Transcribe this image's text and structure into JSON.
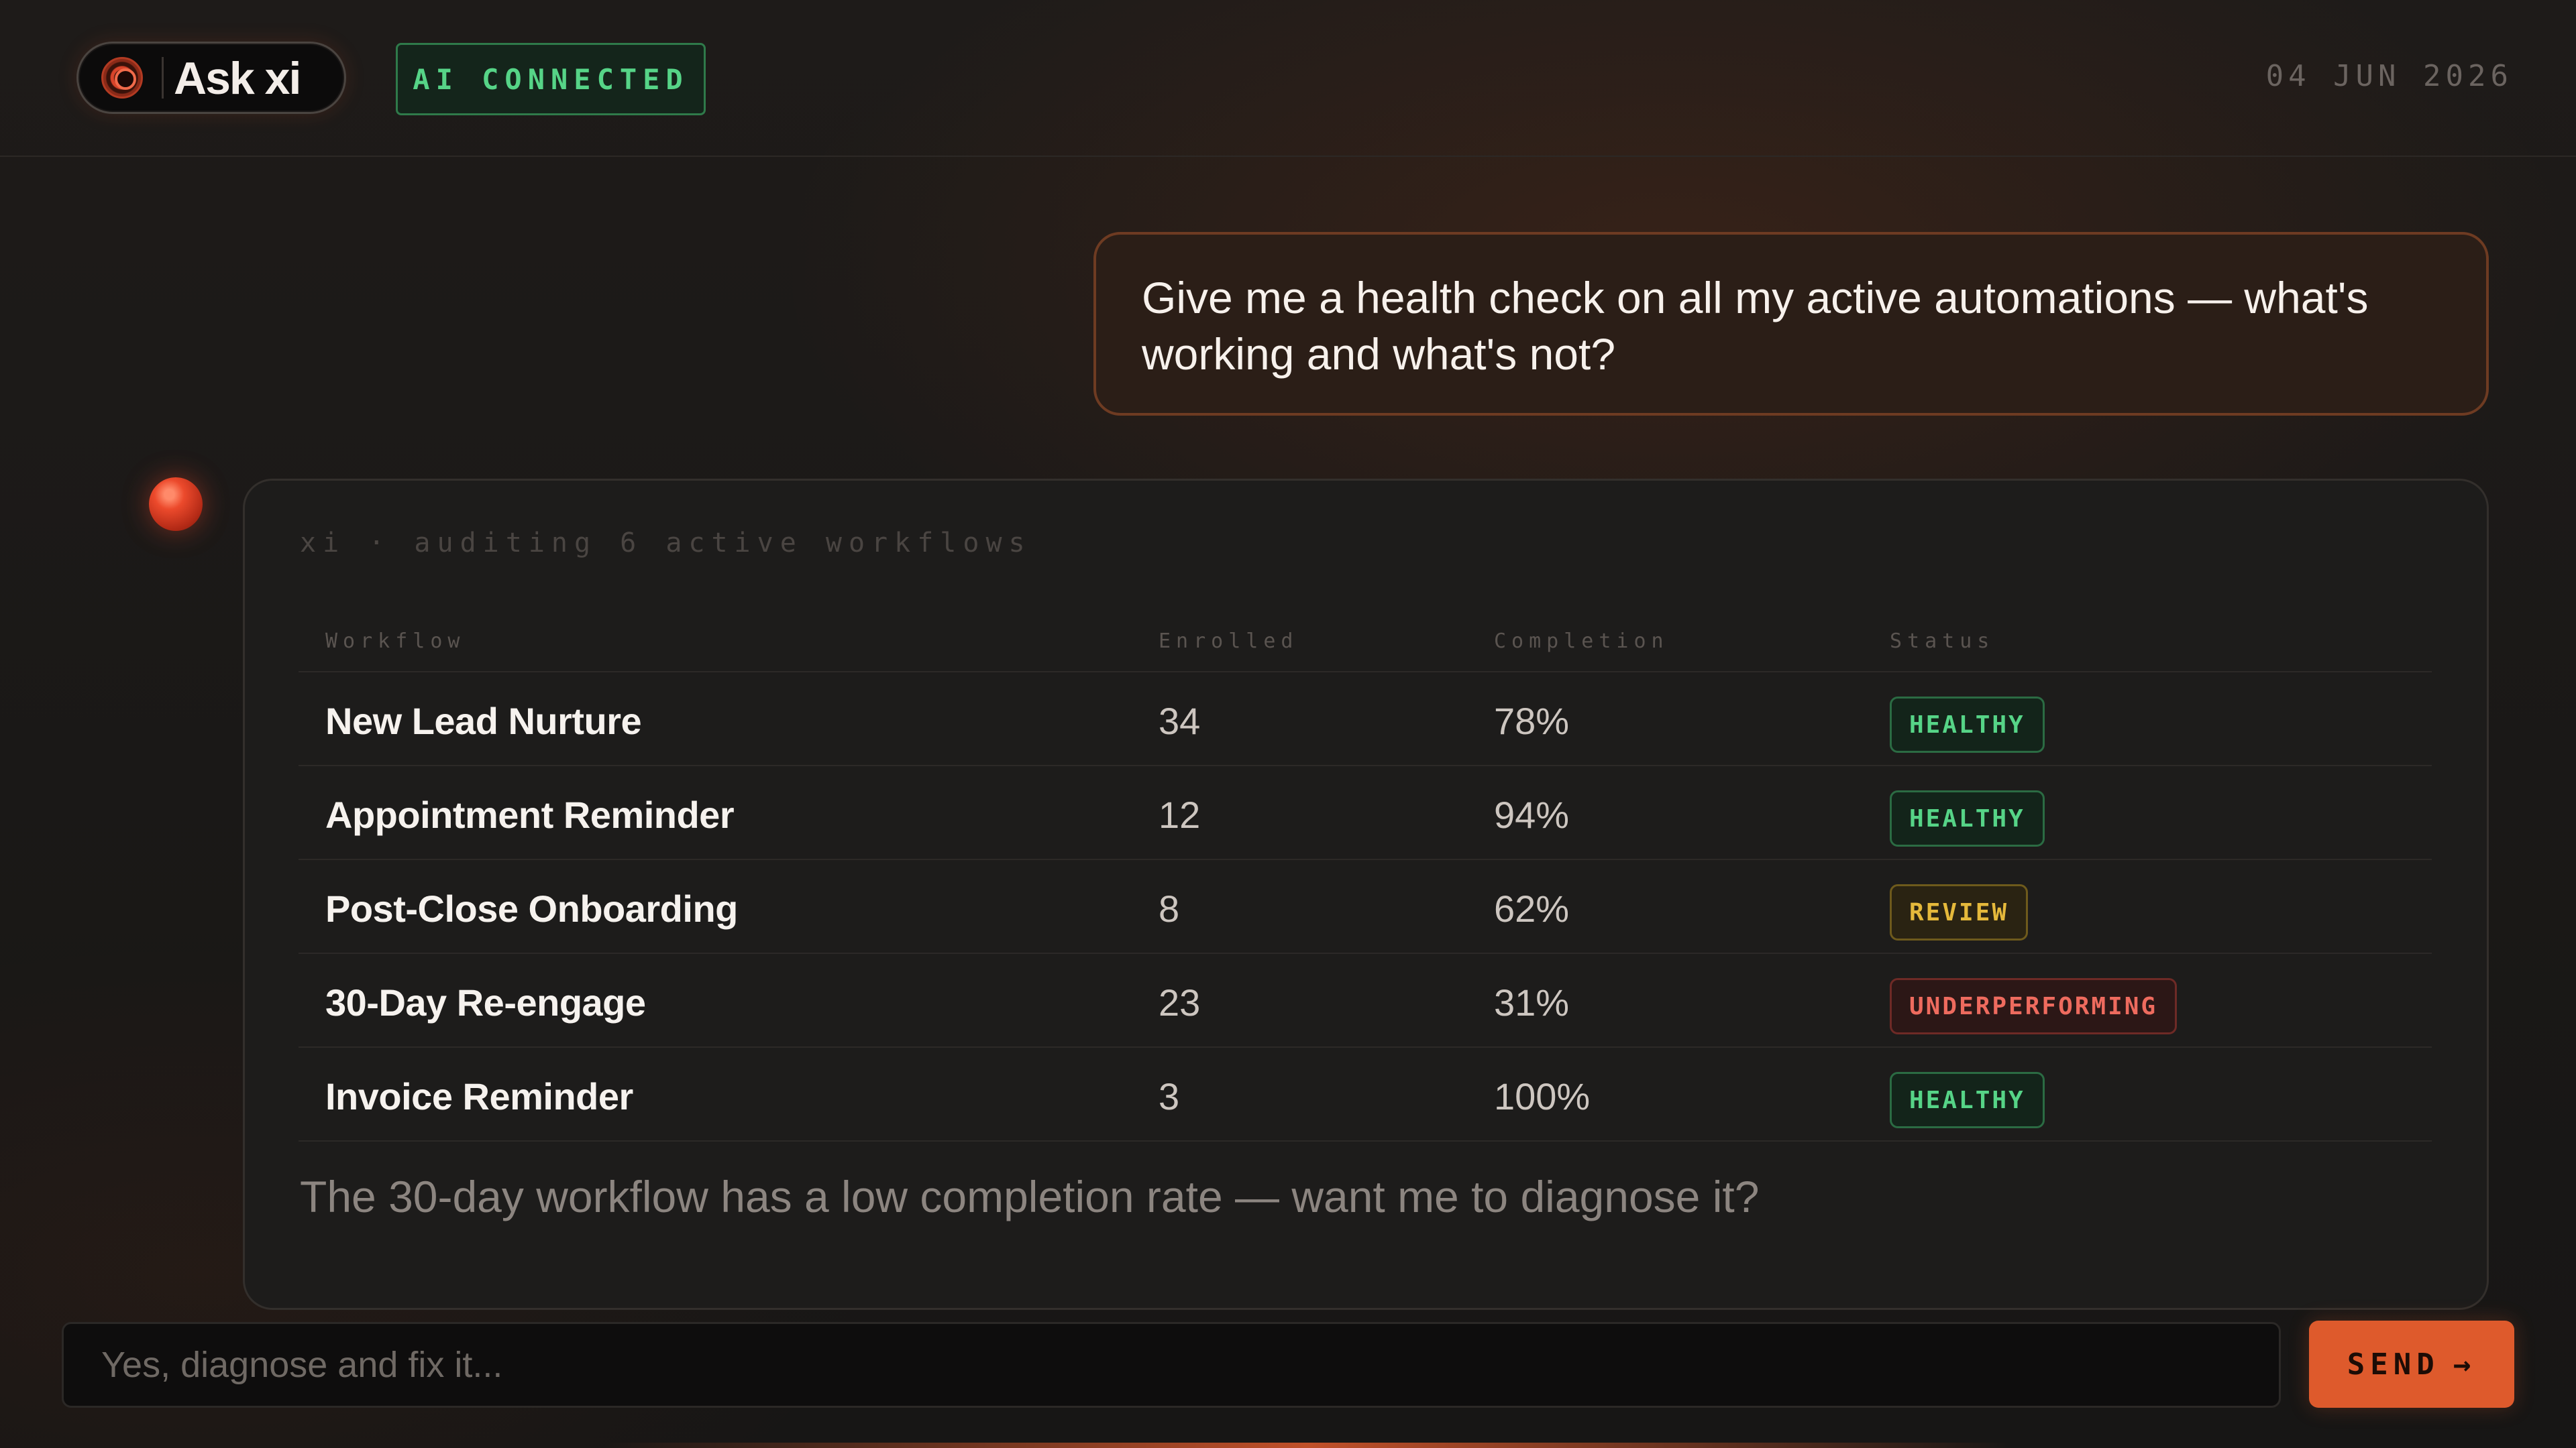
{
  "header": {
    "brand": "Ask xi",
    "status": "AI CONNECTED",
    "date": "04 JUN 2026"
  },
  "chat": {
    "user_message": "Give me a health check on all my active automations — what's working and what's not?",
    "assistant": {
      "meta": "xi · auditing 6 active workflows",
      "table": {
        "headers": [
          "Workflow",
          "Enrolled",
          "Completion",
          "Status"
        ],
        "rows": [
          {
            "name": "New Lead Nurture",
            "enrolled": "34",
            "completion": "78%",
            "status": "HEALTHY"
          },
          {
            "name": "Appointment Reminder",
            "enrolled": "12",
            "completion": "94%",
            "status": "HEALTHY"
          },
          {
            "name": "Post-Close Onboarding",
            "enrolled": "8",
            "completion": "62%",
            "status": "REVIEW"
          },
          {
            "name": "30-Day Re-engage",
            "enrolled": "23",
            "completion": "31%",
            "status": "UNDERPERFORMING"
          },
          {
            "name": "Invoice Reminder",
            "enrolled": "3",
            "completion": "100%",
            "status": "HEALTHY"
          }
        ]
      },
      "summary": "The 30-day workflow has a low completion rate — want me to diagnose it?"
    }
  },
  "composer": {
    "placeholder": "Yes, diagnose and fix it...",
    "value": "",
    "send_label": "SEND",
    "send_icon": "→"
  },
  "colors": {
    "accent": "#de5a2c",
    "healthy": "#56d487",
    "review": "#e5b93b",
    "underperforming": "#ee6b5e"
  }
}
